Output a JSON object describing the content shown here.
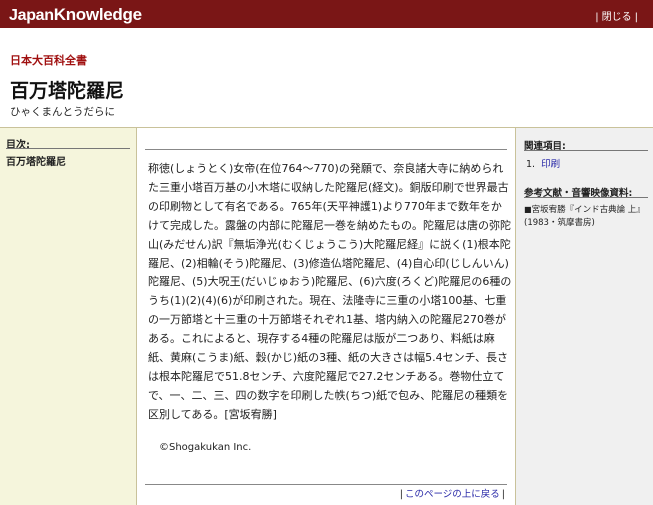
{
  "app": {
    "logo_part1": "Japan",
    "logo_part2": "Knowledge",
    "close_label": "閉じる"
  },
  "header": {
    "book_name": "日本大百科全書",
    "entry_title": "百万塔陀羅尼",
    "entry_reading": "ひゃくまんとうだらに"
  },
  "toc": {
    "heading": "目次:",
    "items": [
      "百万塔陀羅尼"
    ]
  },
  "article": {
    "body": "称徳(しょうとく)女帝(在位764～770)の発願で、奈良諸大寺に納められた三重小塔百万基の小木塔に収納した陀羅尼(経文)。銅版印刷で世界最古の印刷物として有名である。765年(天平神護1)より770年まで数年をかけて完成した。露盤の内部に陀羅尼一巻を納めたもの。陀羅尼は唐の弥陀山(みだせん)訳『無垢浄光(むくじょうこう)大陀羅尼経』に説く(1)根本陀羅尼、(2)相輪(そう)陀羅尼、(3)修造仏塔陀羅尼、(4)自心印(じしんいん)陀羅尼、(5)大呪王(だいじゅおう)陀羅尼、(6)六度(ろくど)陀羅尼の6種のうち(1)(2)(4)(6)が印刷された。現在、法隆寺に三重の小塔100基、七重の一万節塔と十三重の十万節塔それぞれ1基、塔内納入の陀羅尼270巻がある。これによると、現存する4種の陀羅尼は版が二つあり、料紙は麻紙、黄麻(こうま)紙、穀(かじ)紙の3種、紙の大きさは幅5.4センチ、長さは根本陀羅尼で51.8センチ、六度陀羅尼で27.2センチある。巻物仕立てで、一、二、三、四の数字を印刷した帙(ちつ)紙で包み、陀羅尼の種類を区別してある。[宮坂宥勝]",
    "copyright": "©Shogakukan Inc.",
    "page_top_label": "このページの上に戻る"
  },
  "related": {
    "heading": "関連項目:",
    "items": [
      {
        "number": "1.",
        "label": "印刷"
      }
    ]
  },
  "references": {
    "heading": "参考文献・音響映像資料:",
    "mark": "■",
    "text": "宮坂宥勝『インド古典論 上』(1983・筑摩書房)"
  },
  "colors": {
    "topbar": "#7a1616",
    "left_bg": "#f5f5dc",
    "right_bg": "#f0f0f0",
    "link": "#2a2aa8",
    "book_name": "#a01010"
  }
}
